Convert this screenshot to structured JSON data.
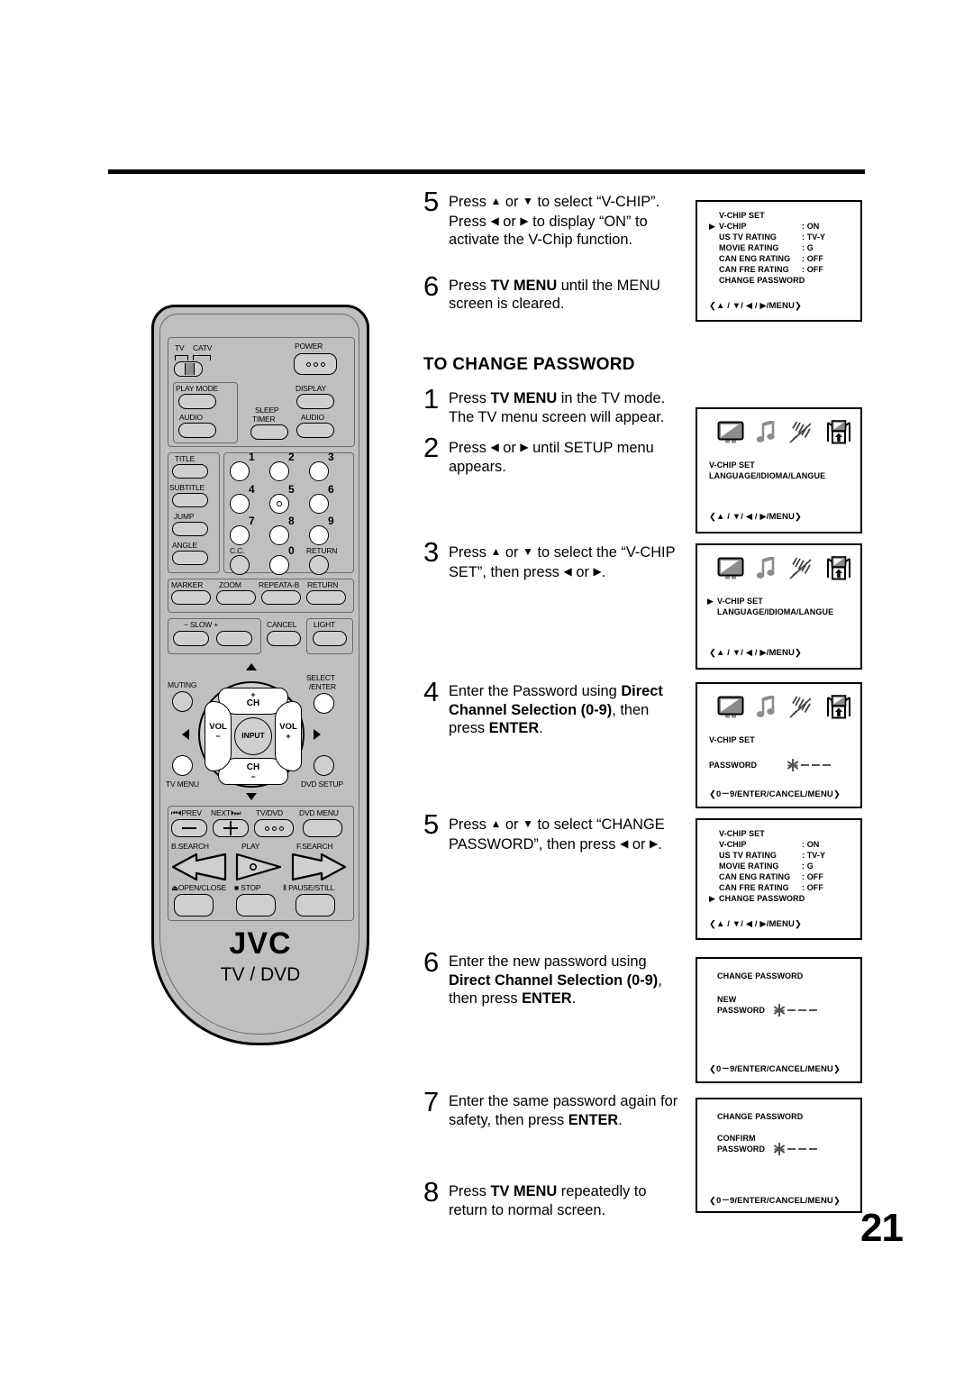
{
  "page": {
    "number": "21"
  },
  "section_heading": "TO CHANGE PASSWORD",
  "prev_steps": [
    {
      "num": "5",
      "html": "Press <span class='gl'>▲</span> or <span class='gl'>▼</span> to select “V-CHIP”. Press <span class='gl'>◀</span> or <span class='gl'>▶</span> to display “ON” to activate the V-Chip function."
    },
    {
      "num": "6",
      "html": "Press <b>TV MENU</b> until the MENU screen is cleared."
    }
  ],
  "steps": [
    {
      "num": "1",
      "html": "Press <b>TV MENU</b> in the TV mode. The TV menu screen will appear."
    },
    {
      "num": "2",
      "html": "Press <span class='gl'>◀</span> or <span class='gl'>▶</span> until SETUP menu appears."
    },
    {
      "num": "3",
      "html": "Press <span class='gl'>▲</span> or <span class='gl'>▼</span> to select the “V-CHIP SET”, then press <span class='gl'>◀</span> or <span class='gl'>▶</span>."
    },
    {
      "num": "4",
      "html": "Enter the Password using <b>Direct Channel Selection (0-9)</b>, then press <b>ENTER</b>."
    },
    {
      "num": "5",
      "html": "Press <span class='gl'>▲</span> or <span class='gl'>▼</span> to select “CHANGE PASSWORD”, then press <span class='gl'>◀</span> or <span class='gl'>▶</span>."
    },
    {
      "num": "6",
      "html": "Enter the new password using <b>Direct Channel Selection (0-9)</b>, then press <b>ENTER</b>."
    },
    {
      "num": "7",
      "html": "Enter the same password again for safety, then press <b>ENTER</b>."
    },
    {
      "num": "8",
      "html": "Press <b>TV MENU</b> repeatedly to return to normal screen."
    }
  ],
  "osd": {
    "vchip_set_title": "V-CHIP SET",
    "change_password_title": "CHANGE PASSWORD",
    "footer_nav": "❮▲ / ▼/ ◀ / ▶/MENU❯",
    "footer_num": "❮0－9/ENTER/CANCEL/MENU❯",
    "cursor": "▶",
    "setup_labels": {
      "vchip": "V-CHIP SET",
      "language": "LANGUAGE/IDIOMA/LANGUE"
    },
    "password_label": "PASSWORD",
    "new_label": "NEW",
    "confirm_label": "CONFIRM",
    "rows": [
      {
        "label": "V-CHIP",
        "value": ": ON"
      },
      {
        "label": "US TV RATING",
        "value": ": TV-Y"
      },
      {
        "label": "MOVIE RATING",
        "value": ": G"
      },
      {
        "label": "CAN ENG RATING",
        "value": ": OFF"
      },
      {
        "label": "CAN FRE RATING",
        "value": ": OFF"
      },
      {
        "label": "CHANGE PASSWORD",
        "value": ""
      }
    ]
  },
  "remote": {
    "brand": "JVC",
    "sub_brand": "TV / DVD",
    "switch_tv": "TV",
    "switch_catv": "CATV",
    "power": "POWER",
    "play_mode": "PLAY MODE",
    "audio_left": "AUDIO",
    "sleep": "SLEEP",
    "timer": "TIMER",
    "display": "DISPLAY",
    "audio_right": "AUDIO",
    "title": "TITLE",
    "subtitle": "SUBTITLE",
    "jump": "JUMP",
    "angle": "ANGLE",
    "cc": "C.C.",
    "return_kp": "RETURN",
    "keys": [
      "1",
      "2",
      "3",
      "4",
      "5",
      "6",
      "7",
      "8",
      "9",
      "0"
    ],
    "marker": "MARKER",
    "zoom": "ZOOM",
    "repeat_ab": "REPEATA-B",
    "return_row": "RETURN",
    "slow": "− SLOW +",
    "cancel": "CANCEL",
    "light": "LIGHT",
    "muting": "MUTING",
    "select_enter_1": "SELECT",
    "select_enter_2": "/ENTER",
    "ch_plus_sign": "+",
    "ch_up": "CH",
    "ch_down": "CH",
    "ch_minus_sign": "−",
    "vol_left": "VOL",
    "vol_left_sign": "−",
    "vol_right": "VOL",
    "vol_right_sign": "+",
    "input": "INPUT",
    "tv_menu": "TV MENU",
    "dvd_setup": "DVD SETUP",
    "prev": "⏮⏴PREV",
    "next": "NEXT⏵⏭",
    "tv_dvd": "TV/DVD",
    "dvd_menu": "DVD MENU",
    "b_search": "B.SEARCH",
    "play": "PLAY",
    "f_search": "F.SEARCH",
    "open_close": "⏏OPEN/CLOSE",
    "stop": "■ STOP",
    "pause_still": "Ⅱ PAUSE/STILL"
  }
}
